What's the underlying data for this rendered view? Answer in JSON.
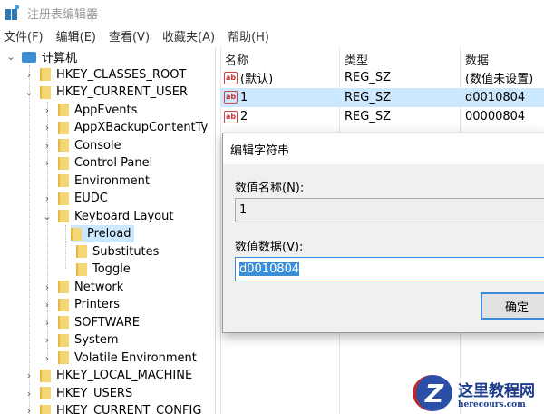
{
  "window": {
    "title": "注册表编辑器"
  },
  "menu": [
    "文件(F)",
    "编辑(E)",
    "查看(V)",
    "收藏夹(A)",
    "帮助(H)"
  ],
  "tree": [
    {
      "label": "计算机",
      "level": 0,
      "arrow": "⌄",
      "type": "pc"
    },
    {
      "label": "HKEY_CLASSES_ROOT",
      "level": 1,
      "arrow": "›"
    },
    {
      "label": "HKEY_CURRENT_USER",
      "level": 1,
      "arrow": "⌄"
    },
    {
      "label": "AppEvents",
      "level": 2,
      "arrow": "›"
    },
    {
      "label": "AppXBackupContentTy",
      "level": 2,
      "arrow": "›"
    },
    {
      "label": "Console",
      "level": 2,
      "arrow": "›"
    },
    {
      "label": "Control Panel",
      "level": 2,
      "arrow": "›"
    },
    {
      "label": "Environment",
      "level": 2,
      "arrow": ""
    },
    {
      "label": "EUDC",
      "level": 2,
      "arrow": "›"
    },
    {
      "label": "Keyboard Layout",
      "level": 2,
      "arrow": "⌄"
    },
    {
      "label": "Preload",
      "level": 3,
      "arrow": "",
      "selected": true
    },
    {
      "label": "Substitutes",
      "level": 3,
      "arrow": ""
    },
    {
      "label": "Toggle",
      "level": 3,
      "arrow": ""
    },
    {
      "label": "Network",
      "level": 2,
      "arrow": "›"
    },
    {
      "label": "Printers",
      "level": 2,
      "arrow": "›"
    },
    {
      "label": "SOFTWARE",
      "level": 2,
      "arrow": "›"
    },
    {
      "label": "System",
      "level": 2,
      "arrow": "›"
    },
    {
      "label": "Volatile Environment",
      "level": 2,
      "arrow": "›"
    },
    {
      "label": "HKEY_LOCAL_MACHINE",
      "level": 1,
      "arrow": "›"
    },
    {
      "label": "HKEY_USERS",
      "level": 1,
      "arrow": "›"
    },
    {
      "label": "HKEY_CURRENT_CONFIG",
      "level": 1,
      "arrow": "›"
    }
  ],
  "list": {
    "headers": [
      "名称",
      "类型",
      "数据"
    ],
    "rows": [
      {
        "name": "(默认)",
        "type": "REG_SZ",
        "data": "(数值未设置)"
      },
      {
        "name": "1",
        "type": "REG_SZ",
        "data": "d0010804",
        "selected": true
      },
      {
        "name": "2",
        "type": "REG_SZ",
        "data": "00000804"
      }
    ],
    "icon_text": "ab"
  },
  "dialog": {
    "title": "编辑字符串",
    "name_label": "数值名称(N):",
    "name_value": "1",
    "data_label": "数值数据(V):",
    "data_value": "d0010804",
    "ok": "确定"
  },
  "watermark": {
    "name": "这里教程网",
    "url": "herecours.com",
    "logo": "Z"
  }
}
